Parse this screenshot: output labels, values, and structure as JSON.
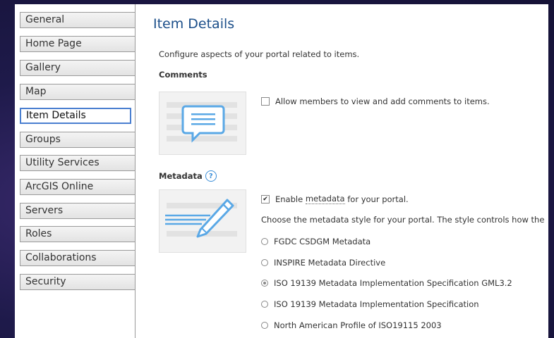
{
  "sidebar": {
    "items": [
      {
        "label": "General",
        "active": false
      },
      {
        "label": "Home Page",
        "active": false
      },
      {
        "label": "Gallery",
        "active": false
      },
      {
        "label": "Map",
        "active": false
      },
      {
        "label": "Item Details",
        "active": true
      },
      {
        "label": "Groups",
        "active": false
      },
      {
        "label": "Utility Services",
        "active": false
      },
      {
        "label": "ArcGIS Online",
        "active": false
      },
      {
        "label": "Servers",
        "active": false
      },
      {
        "label": "Roles",
        "active": false
      },
      {
        "label": "Collaborations",
        "active": false
      },
      {
        "label": "Security",
        "active": false
      }
    ]
  },
  "main": {
    "title": "Item Details",
    "intro": "Configure aspects of your portal related to items.",
    "comments": {
      "heading": "Comments",
      "allow_label": "Allow members to view and add comments to items.",
      "allow_checked": false
    },
    "metadata": {
      "heading": "Metadata",
      "help_glyph": "?",
      "enable_prefix": "Enable",
      "enable_link": "metadata",
      "enable_suffix": "for your portal.",
      "enable_checked": true,
      "style_text": "Choose the metadata style for your portal. The style controls how the",
      "styles": [
        {
          "label": "FGDC CSDGM Metadata",
          "selected": false
        },
        {
          "label": "INSPIRE Metadata Directive",
          "selected": false
        },
        {
          "label": "ISO 19139 Metadata Implementation Specification GML3.2",
          "selected": true
        },
        {
          "label": "ISO 19139 Metadata Implementation Specification",
          "selected": false
        },
        {
          "label": "North American Profile of ISO19115 2003",
          "selected": false
        }
      ]
    }
  },
  "colors": {
    "title": "#1c4f8a",
    "accent": "#4a7fd0",
    "illustration_blue": "#5aa8e6"
  }
}
